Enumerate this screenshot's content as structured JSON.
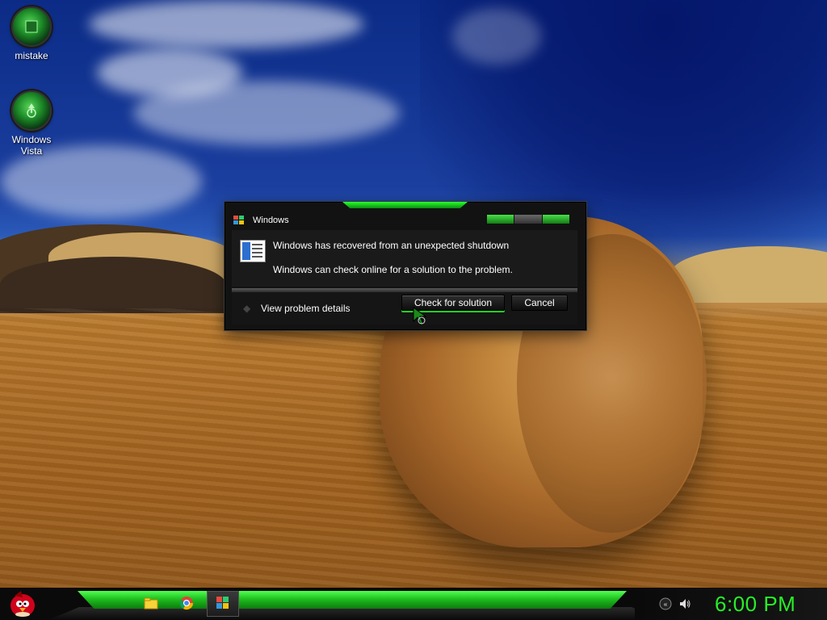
{
  "desktop": {
    "icons": [
      {
        "label": "mistake"
      },
      {
        "label": "Windows Vista"
      }
    ]
  },
  "dialog": {
    "title": "Windows",
    "message_primary": "Windows has recovered from an unexpected shutdown",
    "message_secondary": "Windows can check online for a solution to the problem.",
    "details_label": "View problem details",
    "buttons": {
      "check": "Check for solution",
      "cancel": "Cancel"
    }
  },
  "taskbar": {
    "clock": "6:00 PM",
    "quick_launch": [
      "folder-icon",
      "chrome-icon"
    ],
    "tray_icons": [
      "language-icon",
      "volume-icon"
    ]
  },
  "colors": {
    "accent": "#28ee28",
    "dialog_bg": "#121212",
    "taskbar_bg": "#0a0a0a"
  }
}
